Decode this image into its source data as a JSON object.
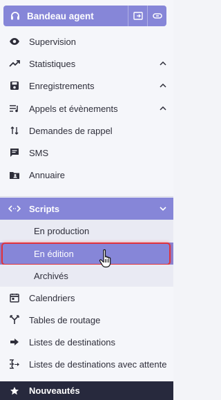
{
  "header": {
    "title": "Bandeau agent",
    "icons": {
      "lead": "headset-icon",
      "popout": "popout-icon",
      "link": "link-icon"
    }
  },
  "menu": [
    {
      "label": "Supervision",
      "icon": "eye-icon",
      "chevron": false
    },
    {
      "label": "Statistiques",
      "icon": "trend-icon",
      "chevron": true
    },
    {
      "label": "Enregistrements",
      "icon": "save-icon",
      "chevron": true
    },
    {
      "label": "Appels et évènements",
      "icon": "list-music-icon",
      "chevron": true
    },
    {
      "label": "Demandes de rappel",
      "icon": "callback-icon",
      "chevron": false
    },
    {
      "label": "SMS",
      "icon": "sms-icon",
      "chevron": false
    },
    {
      "label": "Annuaire",
      "icon": "directory-icon",
      "chevron": false
    }
  ],
  "scripts": {
    "label": "Scripts",
    "icon": "code-icon",
    "subitems": [
      "En production",
      "En édition",
      "Archivés"
    ],
    "selected": "En édition"
  },
  "menu2": [
    {
      "label": "Calendriers",
      "icon": "calendar-icon"
    },
    {
      "label": "Tables de routage",
      "icon": "routing-icon"
    },
    {
      "label": "Listes de destinations",
      "icon": "arrow-right-icon"
    },
    {
      "label": "Listes de destinations avec attente",
      "icon": "queue-icon"
    }
  ],
  "footer": {
    "label": "Nouveautés",
    "icon": "star-icon"
  },
  "colors": {
    "accent": "#8686d8",
    "selection_border": "#e0323c",
    "footer_bg": "#27293d"
  }
}
